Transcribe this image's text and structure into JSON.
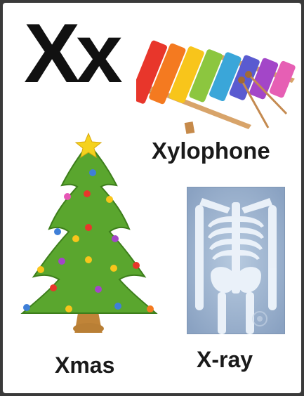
{
  "heading": {
    "letter": "Xx"
  },
  "items": [
    {
      "label": "Xylophone",
      "icon": "xylophone-icon"
    },
    {
      "label": "Xmas",
      "icon": "christmas-tree-icon"
    },
    {
      "label": "X-ray",
      "icon": "xray-icon"
    }
  ],
  "colors": {
    "text": "#1a1a1a",
    "background": "#ffffff",
    "tree_green": "#5aa62e",
    "xray_blue": "#8fa9c9"
  }
}
